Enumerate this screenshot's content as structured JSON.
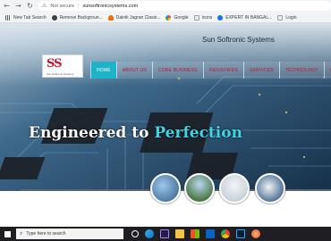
{
  "browser": {
    "security_label": "Not secure",
    "url": "sunsoftronicsystems.com",
    "bookmarks": [
      {
        "label": "New Tab Search",
        "icon": "grid-icon"
      },
      {
        "label": "Remove Backgroun...",
        "icon": "eye-icon"
      },
      {
        "label": "Dainik Jagran Classi...",
        "icon": "fire-icon"
      },
      {
        "label": "Google",
        "icon": "google-icon"
      },
      {
        "label": "icons",
        "icon": "blank-page-icon"
      },
      {
        "label": "EXPERT IN BANGAL...",
        "icon": "globe-icon"
      },
      {
        "label": "Login",
        "icon": "blank-page-icon"
      }
    ]
  },
  "site": {
    "brand_title": "Sun Softronic Systems",
    "logo_text": "SS",
    "logo_subtext": "Sun Softronic Systems",
    "menu": [
      "HOME",
      "ABOUT US",
      "CORE BUSINESS",
      "INDUSTRIES",
      "SERVICES",
      "TECHNOLOGY",
      "CO"
    ],
    "hero_lead": "Engineered to ",
    "hero_accent": "Perfection",
    "colors": {
      "brand_red": "#c8102e",
      "accent_cyan": "#1fb3c9",
      "hero_accent": "#3fd3e6"
    }
  },
  "taskbar": {
    "search_placeholder": "Type here to search",
    "apps": [
      "task-view-icon",
      "edge-icon",
      "premiere-icon",
      "file-explorer-icon",
      "store-icon",
      "mail-icon",
      "chrome-icon",
      "photoshop-icon",
      "firefox-icon"
    ]
  }
}
